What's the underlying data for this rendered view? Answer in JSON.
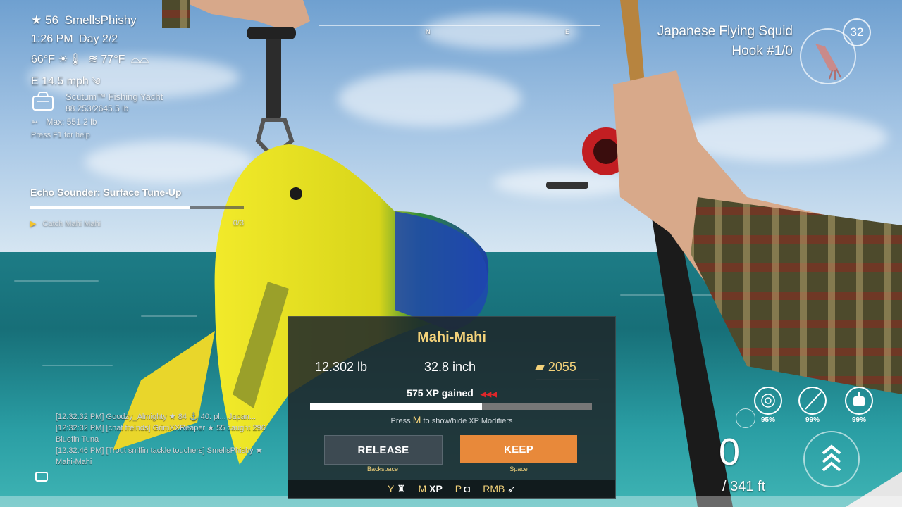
{
  "player": {
    "level": "56",
    "name": "SmellsPhishy"
  },
  "time": {
    "clock": "1:26 PM",
    "day": "Day 2/2"
  },
  "weather": {
    "air_temp": "66°F",
    "water_temp": "77°F",
    "wind": "E 14.5 mph"
  },
  "boat": {
    "name": "Scutum™ Fishing Yacht",
    "capacity": "88.253/2645.5 lb",
    "max": "Max: 551.2 lb"
  },
  "help_hint": "Press F1 for help",
  "quest": {
    "title": "Echo Sounder: Surface Tune-Up",
    "progress_fraction": 0.75,
    "objective": "Catch Mahi Mahi",
    "count": "0/3"
  },
  "compass": {
    "n": "N",
    "e": "E"
  },
  "bait": {
    "name": "Japanese Flying Squid",
    "hook": "Hook #1/0",
    "count": "32"
  },
  "chat": [
    "[12:32:32 PM] Goodzy_Almighty ★ 84 ⚓ 40: pl... Japan...",
    "[12:32:32 PM] [chat freinds] GrimXXReaper ★ 55 caught 296",
    "Bluefin Tuna",
    "[12:32:46 PM] [Trout sniffin tackle touchers] SmellsPhishy ★",
    "Mahi-Mahi"
  ],
  "catch": {
    "species": "Mahi-Mahi",
    "weight": "12.302 lb",
    "length": "32.8 inch",
    "value": "2055",
    "xp": "575 XP gained",
    "xp_fraction": 0.61,
    "xp_hint_pre": "Press",
    "xp_hint_key": "M",
    "xp_hint_post": "to show/hide XP Modifiers",
    "release_label": "RELEASE",
    "release_key": "Backspace",
    "keep_label": "KEEP",
    "keep_key": "Space",
    "hotkeys": [
      {
        "key": "Y",
        "icon": "trophy-icon"
      },
      {
        "key": "M",
        "label": "XP"
      },
      {
        "key": "P",
        "icon": "camera-icon"
      },
      {
        "key": "RMB",
        "icon": "fish-icon"
      }
    ]
  },
  "gear": {
    "line_pct": "95%",
    "rod_pct": "99%",
    "reel_pct": "99%"
  },
  "depth": {
    "current": "0",
    "max": "/ 341 ft"
  },
  "colors": {
    "keep": "#e8893a",
    "release": "#3d4a52",
    "gold": "#f3d27a",
    "xp_red": "#e0262a"
  }
}
